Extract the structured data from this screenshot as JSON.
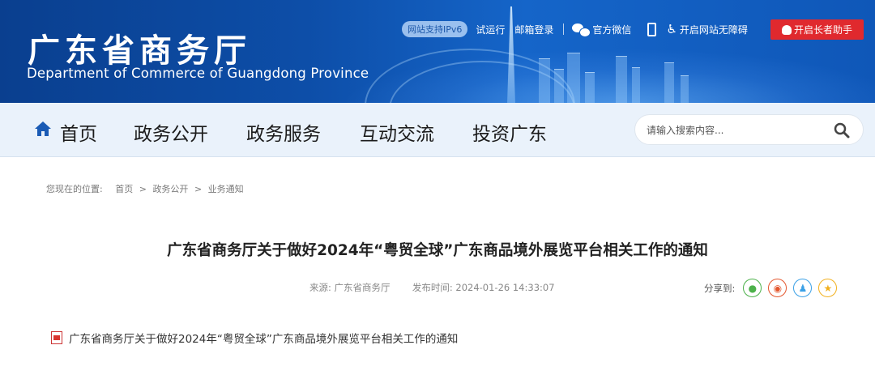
{
  "header": {
    "title": "广东省商务厅",
    "subtitle": "Department of Commerce of Guangdong Province",
    "topbar": {
      "ipv6_badge": "网站支持IPv6",
      "trial_link": "试运行",
      "mail_link": "邮箱登录",
      "wechat_link": "官方微信",
      "accessibility_link": "开启网站无障碍",
      "elder_button": "开启长者助手"
    }
  },
  "nav": {
    "items": [
      "首页",
      "政务公开",
      "政务服务",
      "互动交流",
      "投资广东"
    ],
    "search_placeholder": "请输入搜索内容..."
  },
  "breadcrumb": {
    "prefix": "您现在的位置:",
    "items": [
      "首页",
      "政务公开",
      "业务通知"
    ],
    "separator": ">"
  },
  "article": {
    "title": "广东省商务厅关于做好2024年“粤贸全球”广东商品境外展览平台相关工作的通知",
    "source_label": "来源:",
    "source": "广东省商务厅",
    "time_label": "发布时间:",
    "time": "2024-01-26 14:33:07",
    "share_label": "分享到:",
    "share_icons": [
      "wechat-icon",
      "weibo-icon",
      "qq-icon",
      "qzone-icon"
    ],
    "attachment": "广东省商务厅关于做好2024年“粤贸全球”广东商品境外展览平台相关工作的通知"
  },
  "colors": {
    "banner": "#0d4ea8",
    "nav_bg": "#eaf2fb",
    "elder_button": "#e0292e",
    "wechat": "#4cb14a",
    "weibo": "#e4572e",
    "qq": "#3aa0e6",
    "qzone": "#f2b01e"
  }
}
